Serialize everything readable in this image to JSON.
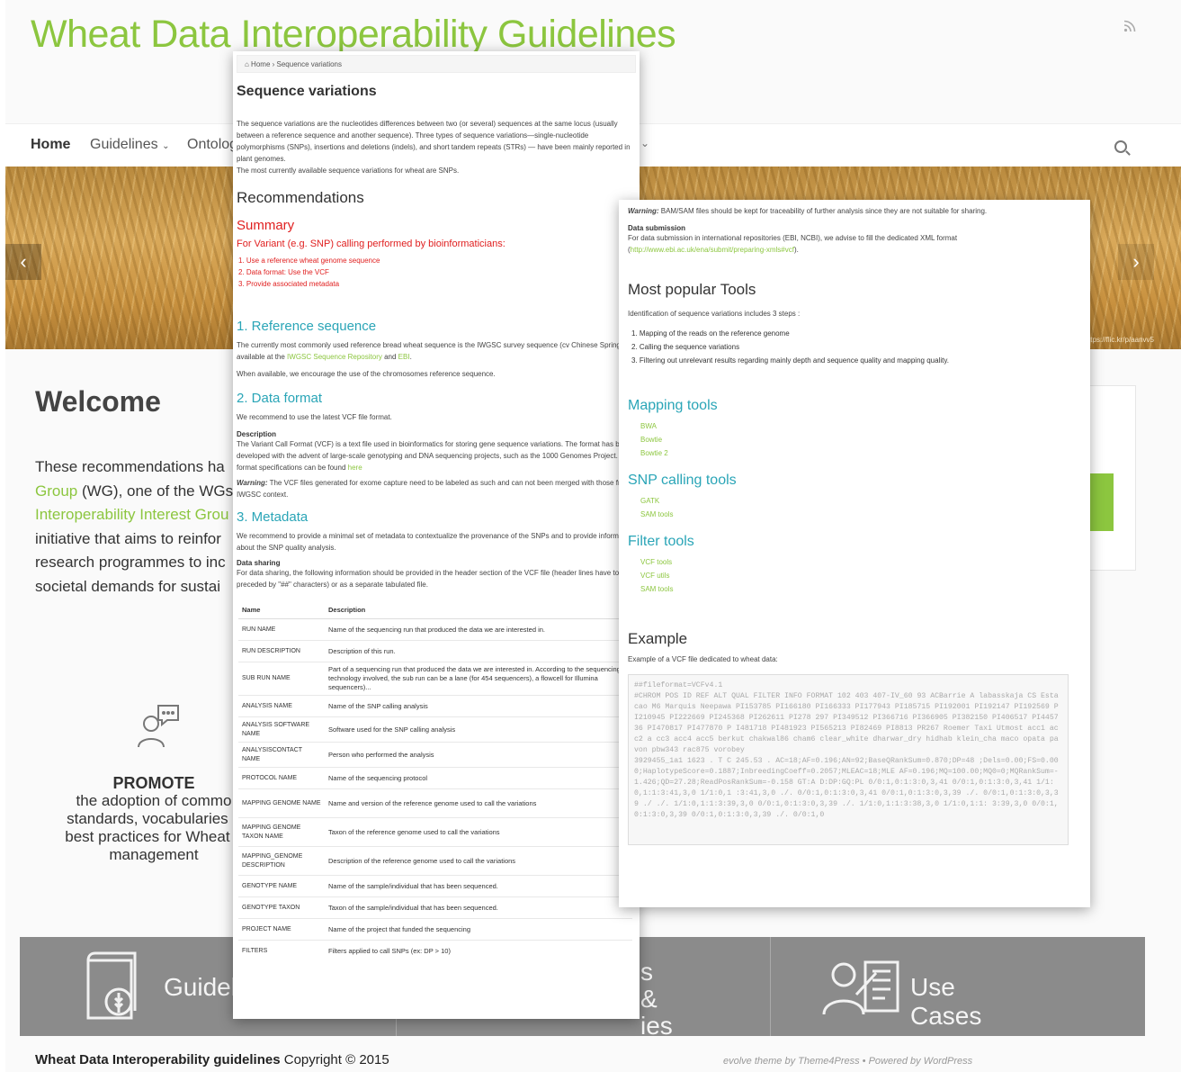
{
  "site": {
    "title": "Wheat Data Interoperability Guidelines",
    "nav": {
      "home": "Home",
      "guidelines": "Guidelines",
      "ontology": "Ontolog",
      "chevron": "⌄"
    },
    "hero_credit": "https://flic.kr/p/aanvv5",
    "welcome": "Welcome",
    "intro_lines": [
      {
        "pre": "These recommendations ha",
        "green": "",
        "post": ""
      },
      {
        "pre": "",
        "green": "Group",
        "post": " (WG), one of the WGs"
      },
      {
        "pre": "",
        "green": "Interoperability Interest Grou",
        "post": ""
      },
      {
        "pre": "initiative that aims to reinfor",
        "green": "",
        "post": ""
      },
      {
        "pre": "research programmes to inc",
        "green": "",
        "post": ""
      },
      {
        "pre": "societal demands for sustai",
        "green": "",
        "post": ""
      }
    ],
    "promote": {
      "title": "PROMOTE",
      "lines": [
        "the adoption of commo",
        "standards, vocabularies a",
        "best practices for Wheat d",
        "management"
      ]
    },
    "bottom_bar": {
      "guide": "Guidel",
      "mid_line1": "s &",
      "mid_line2": "ies",
      "use_cases": "Use Cases"
    },
    "footer": {
      "site_name": "Wheat Data Interoperability guidelines",
      "copyright": " Copyright © 2015",
      "credit": "evolve theme by Theme4Press  •  Powered by WordPress"
    }
  },
  "page1": {
    "breadcrumb": "⌂ Home  ›  Sequence variations",
    "title": "Sequence variations",
    "intro": "The sequence variations are the nucleotides differences between two (or several) sequences at the same locus (usually between a reference sequence and another sequence). Three types of sequence variations—single-nucleotide polymorphisms (SNPs), insertions and deletions (indels), and short tandem repeats (STRs) — have been mainly reported in plant genomes.",
    "intro2": "The most currently available sequence variations for wheat are SNPs.",
    "recommendations": "Recommendations",
    "summary": "Summary",
    "summary_sub": "For Variant (e.g. SNP) calling performed by bioinformaticians:",
    "summary_items": [
      "1.  Use a reference wheat genome sequence",
      "2.  Data format: Use the VCF",
      "3.  Provide associated metadata"
    ],
    "ref_title": "1. Reference sequence",
    "ref_text_a": "The currently most commonly used reference bread wheat sequence is the IWGSC survey sequence (cv Chinese Spring), available at the ",
    "ref_link1": "IWGSC Sequence Repository",
    "ref_text_b": " and ",
    "ref_link2": "EBI",
    "ref_text_c": ".",
    "ref_text2": "When available, we encourage the use of the chromosomes reference sequence.",
    "format_title": "2. Data format",
    "format_text": "We recommend to use the latest VCF file format.",
    "desc_label": "Description",
    "desc_text": "The Variant Call Format (VCF) is a text file used in bioinformatics for storing gene sequence variations. The format has been developed with the advent of large-scale genotyping and DNA sequencing projects, such as the 1000 Genomes Project. VCF format specifications can be found ",
    "desc_link": "here",
    "warn_label": "Warning:",
    "warn_text": " The VCF files generated for exome capture need to be labeled as such and can not been merged with those from IWGSC context.",
    "meta_title": "3. Metadata",
    "meta_text": "We recommend to provide a minimal set of metadata to contextualize the provenance of the SNPs and to provide information about the SNP quality analysis.",
    "sharing_label": "Data sharing",
    "sharing_text": "For data sharing, the following information should be provided in the header section of the VCF file (header lines have to be preceded by \"##\" characters) or as a separate tabulated file.",
    "table": {
      "headers": [
        "Name",
        "Description"
      ],
      "rows": [
        [
          "RUN NAME",
          "Name of the sequencing run that produced the data we are interested in."
        ],
        [
          "RUN DESCRIPTION",
          "Description of this run."
        ],
        [
          "SUB RUN NAME",
          "Part of a sequencing run that produced the data we are interested in. According to the sequencing technology involved, the sub run can be a lane (for 454 sequencers), a flowcell for Illumina sequencers)..."
        ],
        [
          "ANALYSIS NAME",
          "Name of the SNP calling analysis"
        ],
        [
          "ANALYSIS SOFTWARE NAME",
          "Software used for the SNP calling analysis"
        ],
        [
          "ANALYSISCONTACT NAME",
          "Person who performed the analysis"
        ],
        [
          "PROTOCOL NAME",
          "Name of the sequencing protocol"
        ],
        [
          "MAPPING GENOME NAME",
          "Name and version of the reference genome used to call the variations"
        ],
        [
          "MAPPING GENOME TAXON NAME",
          "Taxon of the reference genome used to call the variations"
        ],
        [
          "MAPPING_GENOME DESCRIPTION",
          "Description of the reference genome used to call the variations"
        ],
        [
          "GENOTYPE NAME",
          "Name of the sample/individual that has been sequenced."
        ],
        [
          "GENOTYPE TAXON",
          "Taxon of the sample/individual that has been sequenced."
        ],
        [
          "PROJECT NAME",
          "Name of the project that funded the sequencing"
        ],
        [
          "FILTERS",
          "Filters applied to call SNPs (ex: DP > 10)"
        ]
      ]
    }
  },
  "page2": {
    "warn_label": "Warning:",
    "warn_text": " BAM/SAM files should be kept for traceability of further analysis since they are not suitable for sharing.",
    "submission_label": "Data submission",
    "submission_text": "For data submission in international repositories (EBI, NCBI), we advise to fill the dedicated XML format (",
    "submission_link": "http://www.ebi.ac.uk/ena/submit/preparing-xmls#vcf",
    "submission_end": ").",
    "tools_title": "Most popular Tools",
    "tools_intro": "Identification of sequence variations includes 3 steps :",
    "steps": [
      "1.  Mapping of the reads on the reference genome",
      "2.  Calling the sequence variations",
      "3.  Filtering out unrelevant results regarding mainly depth and sequence quality and mapping quality."
    ],
    "mapping_title": "Mapping tools",
    "mapping_tools": [
      "BWA",
      "Bowtie",
      "Bowtie 2"
    ],
    "snp_title": "SNP calling tools",
    "snp_tools": [
      "GATK",
      "SAM tools"
    ],
    "filter_title": "Filter tools",
    "filter_tools": [
      "VCF tools",
      "VCF utils",
      "SAM tools"
    ],
    "example_title": "Example",
    "example_intro": "Example of a VCF file dedicated to wheat data:",
    "code": "##fileformat=VCFv4.1\n#CHROM POS ID REF ALT QUAL FILTER INFO FORMAT 102 403 407-IV_60 93 ACBarrie A labasskaja CS Estacao M6 Marquis Neepawa PI153785 PI166180 PI166333 PI177943 PI185715 PI192001 PI192147 PI192569 PI210945 PI222669 PI245368 PI262611 PI278 297 PI349512 PI366716 PI366905 PI382150 PI406517 PI445736 PI470817 PI477870 P I481718 PI481923 PI565213 PI82469 PI8813 PR267 Roemer Taxi Utmost acc1 acc2 a cc3 acc4 acc5 berkut chakwal86 cham6 clear_white dharwar_dry hidhab klein_cha maco opata pavon pbw343 rac875 vorobey\n3929455_1a1 1623 . T C 245.53 . AC=18;AF=0.196;AN=92;BaseQRankSum=0.870;DP=48 ;Dels=0.00;FS=0.000;HaplotypeScore=0.1887;InbreedingCoeff=0.2057;MLEAC=18;MLE AF=0.196;MQ=100.00;MQ0=0;MQRankSum=-1.426;QD=27.28;ReadPosRankSum=-0.158 GT:A D:DP:GQ:PL 0/0:1,0:1:3:0,3,41 0/0:1,0:1:3:0,3,41 1/1:0,1:1:3:41,3,0 1/1:0,1 :3:41,3,0 ./. 0/0:1,0:1:3:0,3,41 0/0:1,0:1:3:0,3,39 ./. 0/0:1,0:1:3:0,3,39 ./ ./. 1/1:0,1:1:3:39,3,0 0/0:1,0:1:3:0,3,39 ./. 1/1:0,1:1:3:38,3,0 1/1:0,1:1: 3:39,3,0 0/0:1,0:1:3:0,3,39 0/0:1,0:1:3:0,3,39 ./. 0/0:1,0"
  },
  "colors": {
    "brand_green": "#8cc63f",
    "heading_teal": "#2aa5b7",
    "summary_red": "#e02020",
    "bar_grey": "#8b8b8b"
  }
}
